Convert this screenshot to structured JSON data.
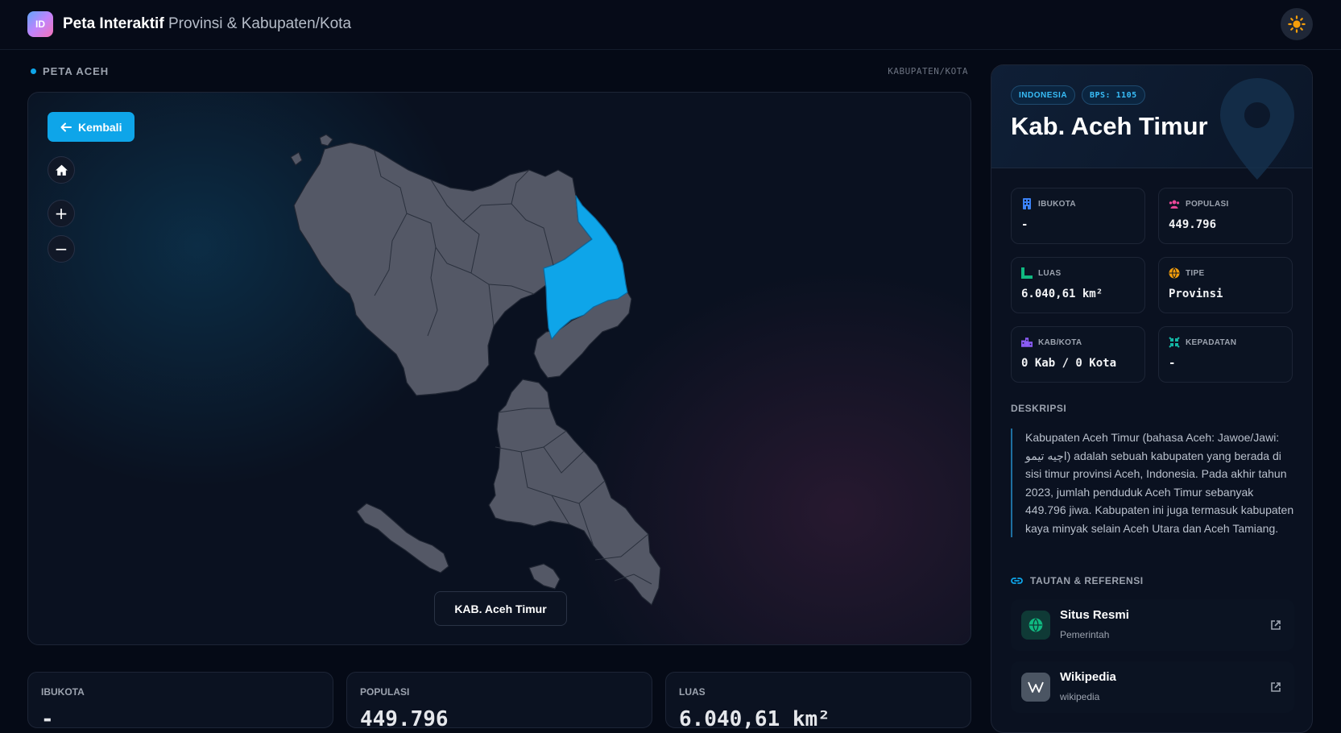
{
  "app": {
    "logo": "ID",
    "title_bold": "Peta Interaktif",
    "title_rest": "Provinsi & Kabupaten/Kota"
  },
  "section": {
    "label": "PETA ACEH",
    "right_label": "KABUPATEN/KOTA"
  },
  "map": {
    "back_label": "Kembali",
    "home_icon": "home-icon",
    "zoom_in": "+",
    "zoom_out": "−",
    "selected_label": "KAB. Aceh Timur",
    "highlight_color": "#0ea5e9",
    "region_color": "#545866"
  },
  "stats": [
    {
      "label": "IBUKOTA",
      "value": "-"
    },
    {
      "label": "POPULASI",
      "value": "449.796"
    },
    {
      "label": "LUAS",
      "value": "6.040,61 km²"
    }
  ],
  "panel": {
    "badge_country": "INDONESIA",
    "badge_bps": "BPS: 1105",
    "title": "Kab. Aceh Timur",
    "info": [
      {
        "label": "IBUKOTA",
        "value": "-",
        "icon": "building-icon",
        "color": "#3b82f6"
      },
      {
        "label": "POPULASI",
        "value": "449.796",
        "icon": "users-icon",
        "color": "#ec4899"
      },
      {
        "label": "LUAS",
        "value": "6.040,61 km²",
        "icon": "ruler-icon",
        "color": "#10b981"
      },
      {
        "label": "TIPE",
        "value": "Provinsi",
        "icon": "globe-icon",
        "color": "#f59e0b"
      },
      {
        "label": "KAB/KOTA",
        "value": "0 Kab / 0 Kota",
        "icon": "city-icon",
        "color": "#8b5cf6"
      },
      {
        "label": "KEPADATAN",
        "value": "-",
        "icon": "compress-icon",
        "color": "#14b8a6"
      }
    ],
    "desc_heading": "DESKRIPSI",
    "description": "Kabupaten Aceh Timur (bahasa Aceh: Jawoe/Jawi: اچيه تيمو) adalah sebuah kabupaten yang berada di sisi timur provinsi Aceh, Indonesia. Pada akhir tahun 2023, jumlah penduduk Aceh Timur sebanyak 449.796 jiwa. Kabupaten ini juga termasuk kabupaten kaya minyak selain Aceh Utara dan Aceh Tamiang.",
    "links_heading": "TAUTAN & REFERENSI",
    "links": [
      {
        "title": "Situs Resmi",
        "subtitle": "Pemerintah",
        "icon": "globe-icon"
      },
      {
        "title": "Wikipedia",
        "subtitle": "wikipedia",
        "icon": "wikipedia-icon"
      }
    ]
  }
}
